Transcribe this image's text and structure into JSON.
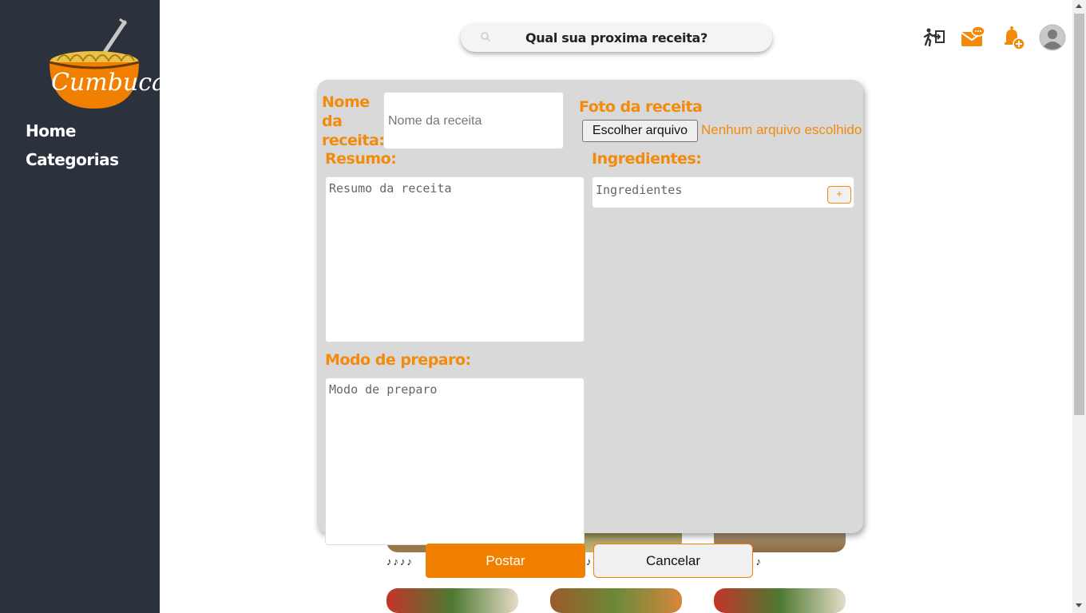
{
  "app": {
    "logo_text": "Cumbuca"
  },
  "sidebar": {
    "items": [
      {
        "label": "Home"
      },
      {
        "label": "Categorias"
      }
    ]
  },
  "search": {
    "text": "Qual sua proxima receita?",
    "icon": "search-icon"
  },
  "header_icons": [
    "logout-icon",
    "messages-icon",
    "notifications-add-icon",
    "avatar-icon"
  ],
  "colors": {
    "accent": "#f28000",
    "sidebar_bg": "#2c323d",
    "modal_bg": "#d9d9d9"
  },
  "form": {
    "name_label": "Nome da receita:",
    "name_placeholder": "Nome da receita",
    "photo_label": "Foto da receita",
    "file_button": "Escolher arquivo",
    "file_status": "Nenhum arquivo escolhido",
    "summary_label": "Resumo:",
    "summary_placeholder": "Resumo da receita",
    "ingredients_label": "Ingredientes:",
    "ingredients_placeholder": "Ingredientes",
    "add_ingredient": "+",
    "method_label": "Modo de preparo:",
    "method_placeholder": "Modo de preparo",
    "post_button": "Postar",
    "cancel_button": "Cancelar"
  }
}
